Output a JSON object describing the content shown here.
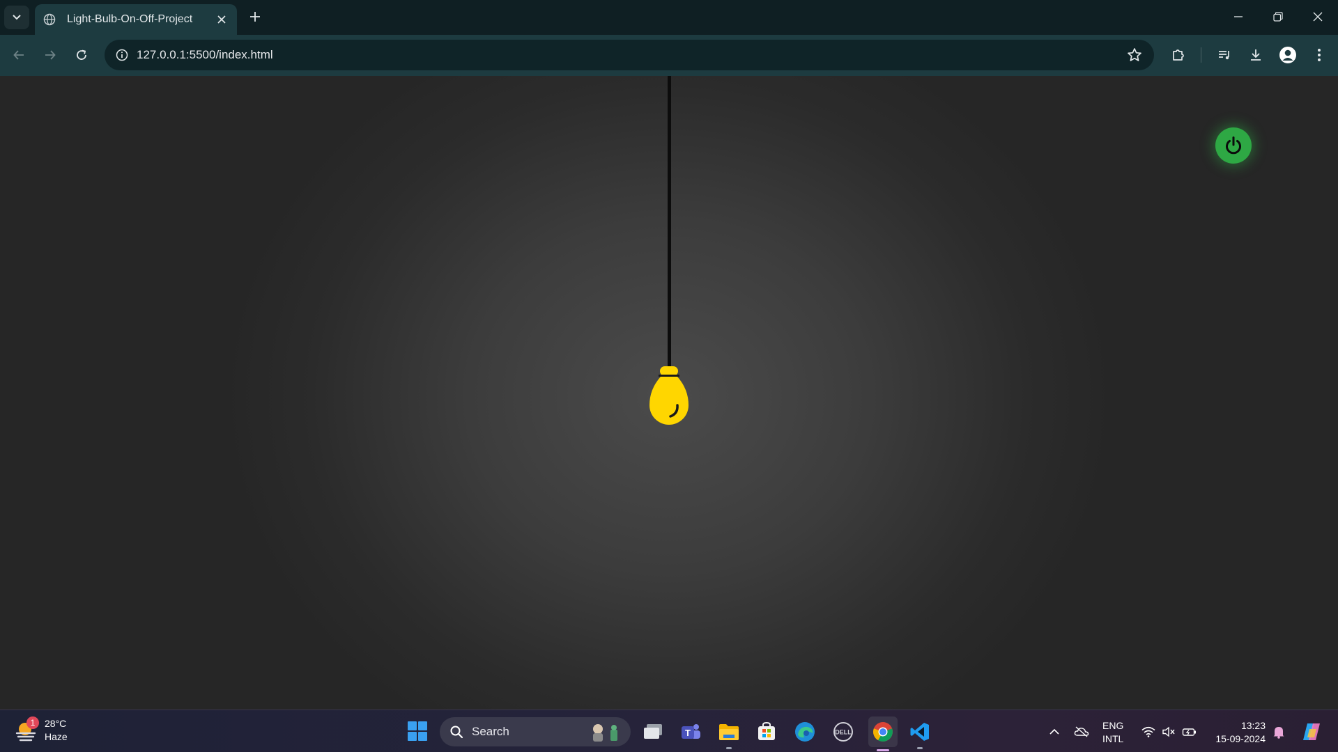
{
  "browser": {
    "tab": {
      "title": "Light-Bulb-On-Off-Project",
      "icon": "globe-icon"
    },
    "url": "127.0.0.1:5500/index.html"
  },
  "page": {
    "bulb_state": "on",
    "colors": {
      "bulb": "#ffd600",
      "power_button": "#2ea844",
      "background_center": "#4b4b4b",
      "background_edge": "#262626",
      "cord": "#0c0c0c"
    }
  },
  "taskbar": {
    "weather": {
      "temp": "28°C",
      "condition": "Haze",
      "badge": "1"
    },
    "search": {
      "label": "Search"
    },
    "apps": [
      "task-view",
      "teams",
      "file-explorer",
      "microsoft-store",
      "edge",
      "dell",
      "chrome",
      "vscode"
    ],
    "language": {
      "line1": "ENG",
      "line2": "INTL"
    },
    "clock": {
      "time": "13:23",
      "date": "15-09-2024"
    }
  }
}
